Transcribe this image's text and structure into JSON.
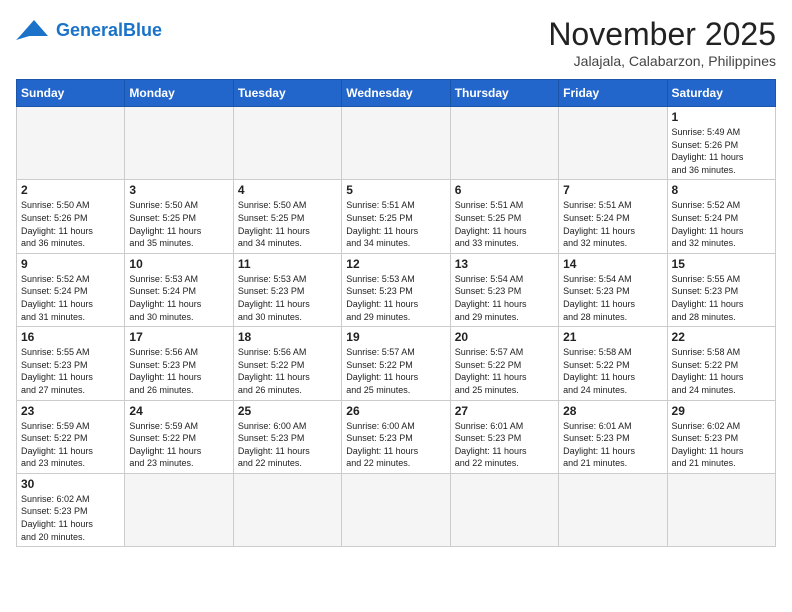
{
  "header": {
    "logo_general": "General",
    "logo_blue": "Blue",
    "month_title": "November 2025",
    "location": "Jalajala, Calabarzon, Philippines"
  },
  "weekdays": [
    "Sunday",
    "Monday",
    "Tuesday",
    "Wednesday",
    "Thursday",
    "Friday",
    "Saturday"
  ],
  "weeks": [
    [
      {
        "day": "",
        "info": ""
      },
      {
        "day": "",
        "info": ""
      },
      {
        "day": "",
        "info": ""
      },
      {
        "day": "",
        "info": ""
      },
      {
        "day": "",
        "info": ""
      },
      {
        "day": "",
        "info": ""
      },
      {
        "day": "1",
        "info": "Sunrise: 5:49 AM\nSunset: 5:26 PM\nDaylight: 11 hours\nand 36 minutes."
      }
    ],
    [
      {
        "day": "2",
        "info": "Sunrise: 5:50 AM\nSunset: 5:26 PM\nDaylight: 11 hours\nand 36 minutes."
      },
      {
        "day": "3",
        "info": "Sunrise: 5:50 AM\nSunset: 5:25 PM\nDaylight: 11 hours\nand 35 minutes."
      },
      {
        "day": "4",
        "info": "Sunrise: 5:50 AM\nSunset: 5:25 PM\nDaylight: 11 hours\nand 34 minutes."
      },
      {
        "day": "5",
        "info": "Sunrise: 5:51 AM\nSunset: 5:25 PM\nDaylight: 11 hours\nand 34 minutes."
      },
      {
        "day": "6",
        "info": "Sunrise: 5:51 AM\nSunset: 5:25 PM\nDaylight: 11 hours\nand 33 minutes."
      },
      {
        "day": "7",
        "info": "Sunrise: 5:51 AM\nSunset: 5:24 PM\nDaylight: 11 hours\nand 32 minutes."
      },
      {
        "day": "8",
        "info": "Sunrise: 5:52 AM\nSunset: 5:24 PM\nDaylight: 11 hours\nand 32 minutes."
      }
    ],
    [
      {
        "day": "9",
        "info": "Sunrise: 5:52 AM\nSunset: 5:24 PM\nDaylight: 11 hours\nand 31 minutes."
      },
      {
        "day": "10",
        "info": "Sunrise: 5:53 AM\nSunset: 5:24 PM\nDaylight: 11 hours\nand 30 minutes."
      },
      {
        "day": "11",
        "info": "Sunrise: 5:53 AM\nSunset: 5:23 PM\nDaylight: 11 hours\nand 30 minutes."
      },
      {
        "day": "12",
        "info": "Sunrise: 5:53 AM\nSunset: 5:23 PM\nDaylight: 11 hours\nand 29 minutes."
      },
      {
        "day": "13",
        "info": "Sunrise: 5:54 AM\nSunset: 5:23 PM\nDaylight: 11 hours\nand 29 minutes."
      },
      {
        "day": "14",
        "info": "Sunrise: 5:54 AM\nSunset: 5:23 PM\nDaylight: 11 hours\nand 28 minutes."
      },
      {
        "day": "15",
        "info": "Sunrise: 5:55 AM\nSunset: 5:23 PM\nDaylight: 11 hours\nand 28 minutes."
      }
    ],
    [
      {
        "day": "16",
        "info": "Sunrise: 5:55 AM\nSunset: 5:23 PM\nDaylight: 11 hours\nand 27 minutes."
      },
      {
        "day": "17",
        "info": "Sunrise: 5:56 AM\nSunset: 5:23 PM\nDaylight: 11 hours\nand 26 minutes."
      },
      {
        "day": "18",
        "info": "Sunrise: 5:56 AM\nSunset: 5:22 PM\nDaylight: 11 hours\nand 26 minutes."
      },
      {
        "day": "19",
        "info": "Sunrise: 5:57 AM\nSunset: 5:22 PM\nDaylight: 11 hours\nand 25 minutes."
      },
      {
        "day": "20",
        "info": "Sunrise: 5:57 AM\nSunset: 5:22 PM\nDaylight: 11 hours\nand 25 minutes."
      },
      {
        "day": "21",
        "info": "Sunrise: 5:58 AM\nSunset: 5:22 PM\nDaylight: 11 hours\nand 24 minutes."
      },
      {
        "day": "22",
        "info": "Sunrise: 5:58 AM\nSunset: 5:22 PM\nDaylight: 11 hours\nand 24 minutes."
      }
    ],
    [
      {
        "day": "23",
        "info": "Sunrise: 5:59 AM\nSunset: 5:22 PM\nDaylight: 11 hours\nand 23 minutes."
      },
      {
        "day": "24",
        "info": "Sunrise: 5:59 AM\nSunset: 5:22 PM\nDaylight: 11 hours\nand 23 minutes."
      },
      {
        "day": "25",
        "info": "Sunrise: 6:00 AM\nSunset: 5:23 PM\nDaylight: 11 hours\nand 22 minutes."
      },
      {
        "day": "26",
        "info": "Sunrise: 6:00 AM\nSunset: 5:23 PM\nDaylight: 11 hours\nand 22 minutes."
      },
      {
        "day": "27",
        "info": "Sunrise: 6:01 AM\nSunset: 5:23 PM\nDaylight: 11 hours\nand 22 minutes."
      },
      {
        "day": "28",
        "info": "Sunrise: 6:01 AM\nSunset: 5:23 PM\nDaylight: 11 hours\nand 21 minutes."
      },
      {
        "day": "29",
        "info": "Sunrise: 6:02 AM\nSunset: 5:23 PM\nDaylight: 11 hours\nand 21 minutes."
      }
    ],
    [
      {
        "day": "30",
        "info": "Sunrise: 6:02 AM\nSunset: 5:23 PM\nDaylight: 11 hours\nand 20 minutes."
      },
      {
        "day": "",
        "info": ""
      },
      {
        "day": "",
        "info": ""
      },
      {
        "day": "",
        "info": ""
      },
      {
        "day": "",
        "info": ""
      },
      {
        "day": "",
        "info": ""
      },
      {
        "day": "",
        "info": ""
      }
    ]
  ]
}
